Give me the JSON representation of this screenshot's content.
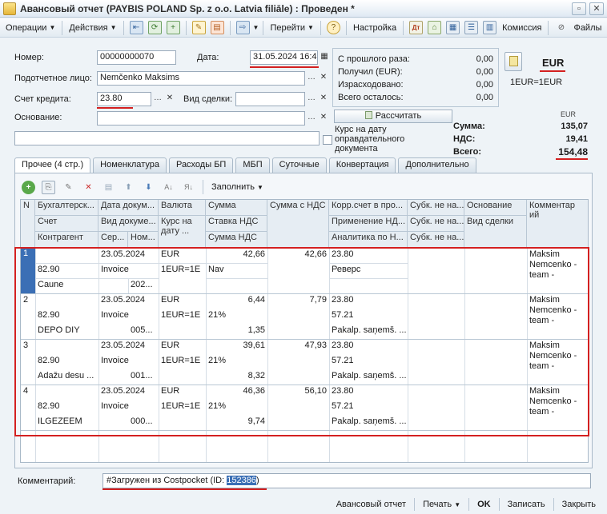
{
  "window": {
    "title": "Авансовый отчет (PAYBIS POLAND Sp. z o.o. Latvia filiāle) : Проведен *",
    "buttons": [
      "▫",
      "✕"
    ]
  },
  "toolbar": {
    "operations": "Операции",
    "actions": "Действия",
    "goto": "Перейти",
    "settings": "Настройка",
    "commission": "Комиссия",
    "files": "Файлы"
  },
  "form": {
    "number_label": "Номер:",
    "number_value": "00000000070",
    "date_label": "Дата:",
    "date_value": "31.05.2024 16:4",
    "accountable_label": "Подотчетное лицо:",
    "accountable_value": "Nemčenko Maksims",
    "credit_account_label": "Счет кредита:",
    "credit_account_value": "23.80",
    "deal_type_label": "Вид сделки:",
    "deal_type_value": "",
    "basis_label": "Основание:",
    "basis_value": ""
  },
  "summary": {
    "rows": [
      {
        "label": "С прошлого раза:",
        "value": "0,00"
      },
      {
        "label": "Получил (EUR):",
        "value": "0,00"
      },
      {
        "label": "Израсходовано:",
        "value": "0,00"
      },
      {
        "label": "Всего осталось:",
        "value": "0,00"
      }
    ],
    "currency": "EUR",
    "rate": "1EUR=1EUR",
    "calculate_button": "Рассчитать",
    "rate_checkbox_label": "Курс на дату оправдательного документа",
    "currency_header": "EUR",
    "sum_label": "Сумма:",
    "sum_value": "135,07",
    "vat_label": "НДС:",
    "vat_value": "19,41",
    "total_label": "Всего:",
    "total_value": "154,48"
  },
  "tabs": [
    {
      "label": "Прочее (4 стр.)",
      "active": true
    },
    {
      "label": "Номенклатура",
      "active": false
    },
    {
      "label": "Расходы БП",
      "active": false
    },
    {
      "label": "МБП",
      "active": false
    },
    {
      "label": "Суточные",
      "active": false
    },
    {
      "label": "Конвертация",
      "active": false
    },
    {
      "label": "Дополнительно",
      "active": false
    }
  ],
  "inner_toolbar": {
    "fill_label": "Заполнить"
  },
  "grid": {
    "headers": {
      "n": "N",
      "acc_doc": "Бухгалтерск...",
      "account": "Счет",
      "counterparty": "Контрагент",
      "doc_date": "Дата докум...",
      "doc_type": "Вид докуме...",
      "series": "Сер...",
      "number": "Ном...",
      "currency": "Валюта",
      "rate": "Курс на дату ...",
      "sum": "Сумма",
      "vat_rate": "Ставка НДС",
      "vat_sum": "Сумма НДС",
      "sum_vat": "Сумма с НДС",
      "corr_account": "Корр.счет в про...",
      "vat_application": "Применение НД...",
      "analytics": "Аналитика по Н...",
      "subk1": "Субк. не на...",
      "subk2": "Субк. не на...",
      "subk3": "Субк. не на...",
      "basis": "Основание",
      "deal_type": "Вид сделки",
      "comment": "Комментар ий"
    },
    "rows": [
      {
        "n": "1",
        "account": "82.90",
        "counterparty": "Caune",
        "date": "23.05.2024",
        "doc_type": "Invoice",
        "doc_num": "202...",
        "currency": "EUR",
        "rate": "1EUR=1E",
        "sum": "42,66",
        "vat_rate": "Nav",
        "vat_sum": "",
        "sum_vat": "42,66",
        "corr1": "23.80",
        "corr2": "Реверс",
        "corr3": "",
        "comment": [
          "Maksim",
          "Nemcenko -",
          "team -"
        ]
      },
      {
        "n": "2",
        "account": "82.90",
        "counterparty": "DEPO DIY",
        "date": "23.05.2024",
        "doc_type": "Invoice",
        "doc_num": "005...",
        "currency": "EUR",
        "rate": "1EUR=1E",
        "sum": "6,44",
        "vat_rate": "21%",
        "vat_sum": "1,35",
        "sum_vat": "7,79",
        "corr1": "23.80",
        "corr2": "57.21",
        "corr3": "Pakalp. saņemš. ...",
        "comment": [
          "Maksim",
          "Nemcenko -",
          "team -"
        ]
      },
      {
        "n": "3",
        "account": "82.90",
        "counterparty": "Adažu desu ...",
        "date": "23.05.2024",
        "doc_type": "Invoice",
        "doc_num": "001...",
        "currency": "EUR",
        "rate": "1EUR=1E",
        "sum": "39,61",
        "vat_rate": "21%",
        "vat_sum": "8,32",
        "sum_vat": "47,93",
        "corr1": "23.80",
        "corr2": "57.21",
        "corr3": "Pakalp. saņemš. ...",
        "comment": [
          "Maksim",
          "Nemcenko -",
          "team -"
        ]
      },
      {
        "n": "4",
        "account": "82.90",
        "counterparty": "ILGEZEEM",
        "date": "23.05.2024",
        "doc_type": "Invoice",
        "doc_num": "000...",
        "currency": "EUR",
        "rate": "1EUR=1E",
        "sum": "46,36",
        "vat_rate": "21%",
        "vat_sum": "9,74",
        "sum_vat": "56,10",
        "corr1": "23.80",
        "corr2": "57.21",
        "corr3": "Pakalp. saņemš. ...",
        "comment": [
          "Maksim",
          "Nemcenko -",
          "team -"
        ]
      }
    ]
  },
  "comment": {
    "label": "Комментарий:",
    "text_prefix": "#Загружен из Costpocket (ID: ",
    "id_value": "152386",
    "text_suffix": ")"
  },
  "bottom": {
    "report": "Авансовый отчет",
    "print": "Печать",
    "ok": "OK",
    "save": "Записать",
    "close": "Закрыть"
  },
  "colors": {
    "highlight_red": "#d42020",
    "selected_row_marker": "#3b6fb5"
  }
}
